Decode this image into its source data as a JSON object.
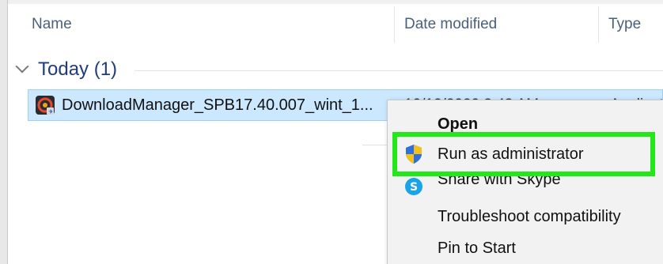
{
  "columns": {
    "name": "Name",
    "date_modified": "Date modified",
    "type": "Type"
  },
  "group": {
    "label": "Today (1)"
  },
  "file": {
    "name": "DownloadManager_SPB17.40.007_wint_1...",
    "date_modified": "10/12/2020 3:43 AM",
    "type": "Application"
  },
  "context_menu": {
    "items": [
      {
        "label": "Open",
        "icon": "none"
      },
      {
        "label": "Run as administrator",
        "icon": "uac-shield-icon"
      },
      {
        "label": "Share with Skype",
        "icon": "skype-icon"
      },
      {
        "label": "Troubleshoot compatibility",
        "icon": "none"
      },
      {
        "label": "Pin to Start",
        "icon": "none"
      }
    ]
  },
  "colors": {
    "selection_bg": "#cce8ff",
    "selection_border": "#99d1ff",
    "highlight": "#22e81a",
    "group_label": "#1f3d7a",
    "header_text": "#4c607a"
  }
}
